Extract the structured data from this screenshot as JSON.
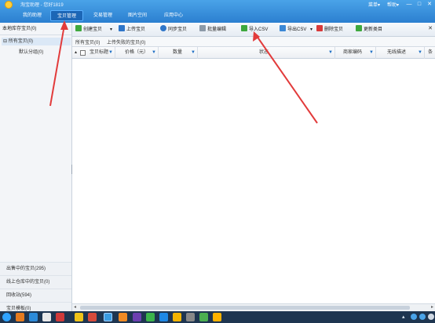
{
  "app": {
    "title": "淘宝助理 - 您好1819",
    "nav_tabs": [
      "我的助理",
      "宝贝管理",
      "交易管理",
      "图片空间",
      "应用中心"
    ],
    "window_controls": {
      "menu": "菜单",
      "help": "帮助",
      "minimize": "—",
      "maximize": "□",
      "close": "✕"
    }
  },
  "toolbar": {
    "create": "创建宝贝",
    "upload": "上传宝贝",
    "sync": "同步宝贝",
    "batch_edit": "批量编辑",
    "import_csv": "导入CSV",
    "export_csv": "导出CSV",
    "delete": "删除宝贝",
    "update_category": "更新类目",
    "close": "✕"
  },
  "sidebar": {
    "title": "本地库存宝贝(0)",
    "tree": {
      "all": "所有宝贝(0)",
      "default_group": "默认分组(0)"
    },
    "bottom": [
      "出售中的宝贝(295)",
      "线上仓库中的宝贝(0)",
      "回收站(594)",
      "宝贝模板(0)"
    ]
  },
  "content": {
    "tabs": [
      "所有宝贝(0)",
      "上传失败的宝贝(0)"
    ],
    "columns": [
      "宝贝标题",
      "价格（元）",
      "数量",
      "状态",
      "商家编码",
      "无线描述",
      "条"
    ]
  },
  "annotation_color": "#e23b3b",
  "icons": {
    "create": "plus-icon",
    "upload": "upload-icon",
    "sync": "sync-icon",
    "batch_edit": "edit-icon",
    "import_csv": "import-icon",
    "export_csv": "export-icon",
    "delete": "delete-icon",
    "update_category": "refresh-icon"
  }
}
